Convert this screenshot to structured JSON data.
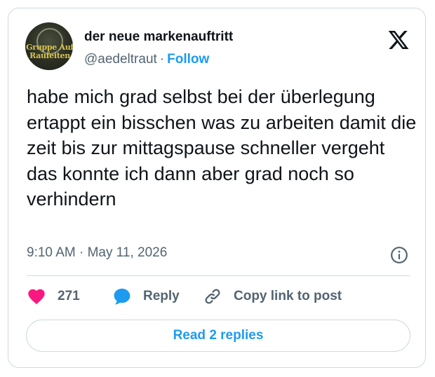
{
  "author": {
    "display_name": "der neue markenauftritt",
    "handle": "@aedeltraut",
    "separator": "·",
    "follow_label": "Follow",
    "avatar_text_line1": "Gruppe Auf",
    "avatar_text_line2": "Raufeiten"
  },
  "tweet": {
    "text": "habe mich grad selbst bei der überlegung ertappt ein bisschen was zu arbeiten damit die zeit bis zur mittagspause schneller vergeht das konnte ich dann aber grad noch so verhindern",
    "timestamp": "9:10 AM · May 11, 2026"
  },
  "actions": {
    "like_count": "271",
    "reply_label": "Reply",
    "copy_label": "Copy link to post"
  },
  "read_replies_label": "Read 2 replies",
  "icons": {
    "brand": "x-logo-icon",
    "info": "info-icon",
    "like": "heart-icon",
    "reply": "speech-bubble-icon",
    "copy": "link-icon"
  },
  "colors": {
    "accent": "#1d9bf0",
    "heart": "#f91880",
    "muted": "#536471",
    "border": "#cfd9de"
  }
}
